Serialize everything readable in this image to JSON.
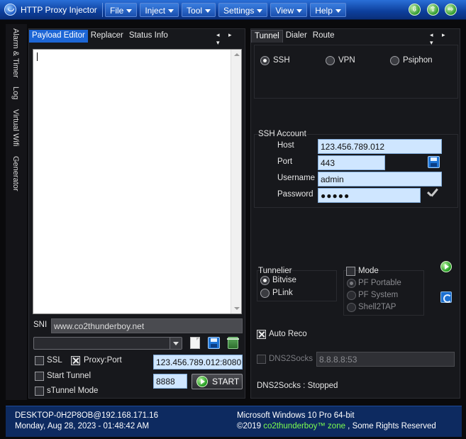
{
  "app": {
    "title": "HTTP Proxy Injector"
  },
  "menu": [
    "File",
    "Inject",
    "Tool",
    "Settings",
    "View",
    "Help"
  ],
  "window_buttons": {
    "down": "⇩",
    "up": "⇧",
    "right": "⇨"
  },
  "side_tabs": [
    "Alarm & Timer",
    "Log",
    "Virtual Wifi",
    "Generator"
  ],
  "left_panel": {
    "tabs": [
      "Payload Editor",
      "Replacer",
      "Status Info"
    ],
    "nav": "◂ ▸ ▾",
    "sni_label": "SNI",
    "sni_value": "www.co2thunderboy.net",
    "ssl_label": "SSL",
    "proxy_port_label": "Proxy:Port",
    "proxy_port_value": "123.456.789.012:8080",
    "start_tunnel_label": "Start Tunnel",
    "stunnel_label": "sTunnel Mode",
    "local_port": "8888",
    "start_label": "START"
  },
  "right_panel": {
    "tabs": [
      "Tunnel",
      "Dialer",
      "Route"
    ],
    "nav": "◂ ▸ ▾",
    "modes": {
      "ssh": "SSH",
      "vpn": "VPN",
      "psiphon": "Psiphon"
    },
    "ssh_account_title": "SSH Account",
    "host_label": "Host",
    "host_value": "123.456.789.012",
    "port_label": "Port",
    "port_value": "443",
    "username_label": "Username",
    "username_value": "admin",
    "password_label": "Password",
    "password_value": "●●●●●",
    "tunnelier_title": "Tunnelier",
    "bitvise_label": "Bitvise",
    "plink_label": "PLink",
    "mode_label": "Mode",
    "pf_portable_label": "PF Portable",
    "pf_system_label": "PF System",
    "shell2tap_label": "Shell2TAP",
    "auto_reco_label": "Auto Reco",
    "dns2socks_label": "DNS2Socks",
    "dns_value": "8.8.8.8:53",
    "dns_status": "DNS2Socks : Stopped"
  },
  "status_bar": {
    "host": "DESKTOP-0H2P8OB@192.168.171.16",
    "datetime": "Monday, Aug 28, 2023 - 01:48:42 AM",
    "os": "Microsoft Windows 10 Pro 64-bit",
    "copyright_prefix": "©2019 ",
    "brand": "co2thunderboy™ zone",
    "copyright_suffix": " , Some Rights Reserved"
  },
  "colors": {
    "accent": "#1d66d6",
    "titlebar": "#0d3f9c",
    "brand": "#7dff4f",
    "field": "#cfe6ff"
  }
}
